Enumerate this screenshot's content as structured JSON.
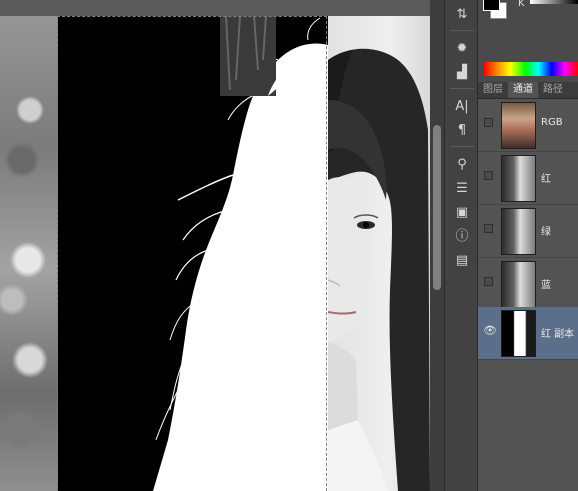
{
  "toolstrip": {
    "icons": [
      "adjust-icon",
      "star-icon",
      "histogram-icon",
      "character-icon",
      "paragraph-icon",
      "brush-icon",
      "sliders-icon",
      "layer-comp-icon",
      "info-icon",
      "notes-icon"
    ]
  },
  "color_panel": {
    "mode_label": "K"
  },
  "tabs": {
    "layers": "图层",
    "channels": "通道",
    "paths": "路径"
  },
  "channels": [
    {
      "label": "RGB",
      "visible": false,
      "selected": false
    },
    {
      "label": "红",
      "visible": false,
      "selected": false
    },
    {
      "label": "绿",
      "visible": false,
      "selected": false
    },
    {
      "label": "蓝",
      "visible": false,
      "selected": false
    },
    {
      "label": "红 副本",
      "visible": true,
      "selected": true
    }
  ]
}
